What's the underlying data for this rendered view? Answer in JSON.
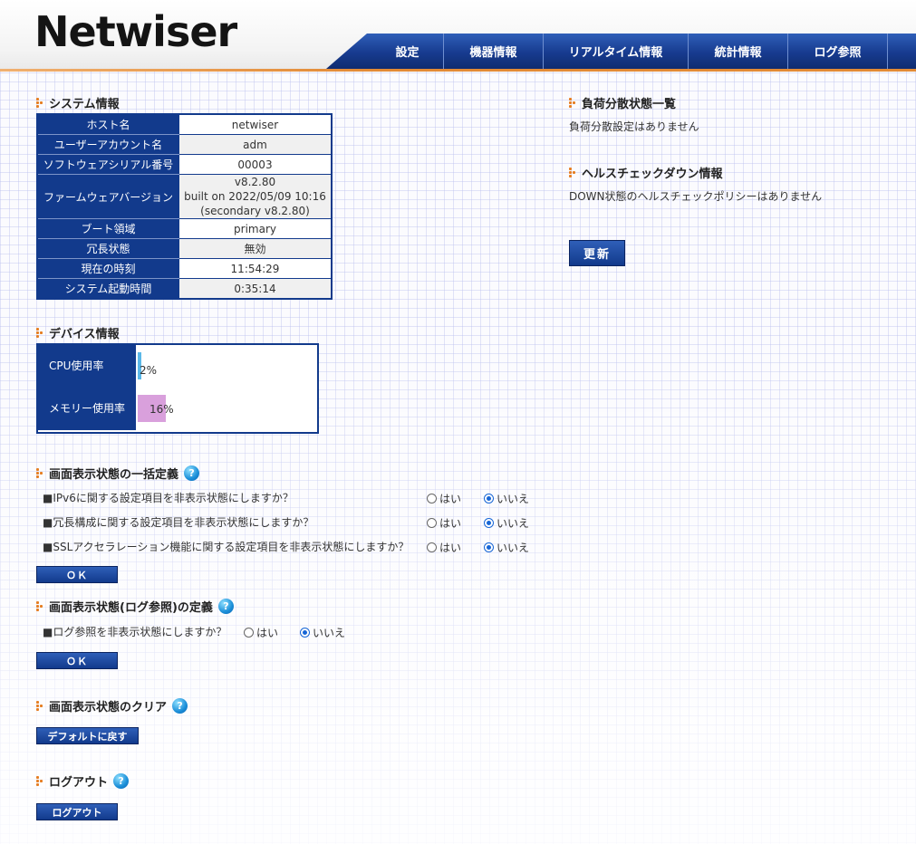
{
  "header": {
    "logo": "Netwiser",
    "nav": [
      "設定",
      "機器情報",
      "リアルタイム情報",
      "統計情報",
      "ログ参照"
    ]
  },
  "system_info": {
    "title": "システム情報",
    "rows": [
      {
        "label": "ホスト名",
        "value": "netwiser"
      },
      {
        "label": "ユーザーアカウント名",
        "value": "adm"
      },
      {
        "label": "ソフトウェアシリアル番号",
        "value": "00003"
      },
      {
        "label": "ファームウェアバージョン",
        "value": "v8.2.80",
        "value2": "built on 2022/05/09 10:16",
        "value3": "(secondary v8.2.80)"
      },
      {
        "label": "ブート領域",
        "value": "primary"
      },
      {
        "label": "冗長状態",
        "value": "無効"
      },
      {
        "label": "現在の時刻",
        "value": "11:54:29"
      },
      {
        "label": "システム起動時間",
        "value": "0:35:14"
      }
    ]
  },
  "device_info": {
    "title": "デバイス情報",
    "cpu": {
      "label": "CPU使用率",
      "value": "2%",
      "percent": 2,
      "color": "#5bb8e8"
    },
    "memory": {
      "label": "メモリー使用率",
      "value": "16%",
      "percent": 16,
      "color": "#d9a0dc"
    }
  },
  "display_bulk": {
    "title": "画面表示状態の一括定義",
    "questions": [
      {
        "text": "■IPv6に関する設定項目を非表示状態にしますか？",
        "yes": "はい",
        "no": "いいえ",
        "selected": "no"
      },
      {
        "text": "■冗長構成に関する設定項目を非表示状態にしますか？",
        "yes": "はい",
        "no": "いいえ",
        "selected": "no"
      },
      {
        "text": "■SSLアクセラレーション機能に関する設定項目を非表示状態にしますか？",
        "yes": "はい",
        "no": "いいえ",
        "selected": "no"
      }
    ],
    "ok_label": "ＯＫ"
  },
  "display_log": {
    "title": "画面表示状態(ログ参照)の定義",
    "question": {
      "text": "■ログ参照を非表示状態にしますか？",
      "yes": "はい",
      "no": "いいえ",
      "selected": "no"
    },
    "ok_label": "ＯＫ"
  },
  "display_clear": {
    "title": "画面表示状態のクリア",
    "button": "デフォルトに戻す"
  },
  "logout": {
    "title": "ログアウト",
    "button": "ログアウト"
  },
  "load_balance": {
    "title": "負荷分散状態一覧",
    "text": "負荷分散設定はありません"
  },
  "health_check": {
    "title": "ヘルスチェックダウン情報",
    "text": "DOWN状態のヘルスチェックポリシーはありません"
  },
  "refresh_button": "更新"
}
